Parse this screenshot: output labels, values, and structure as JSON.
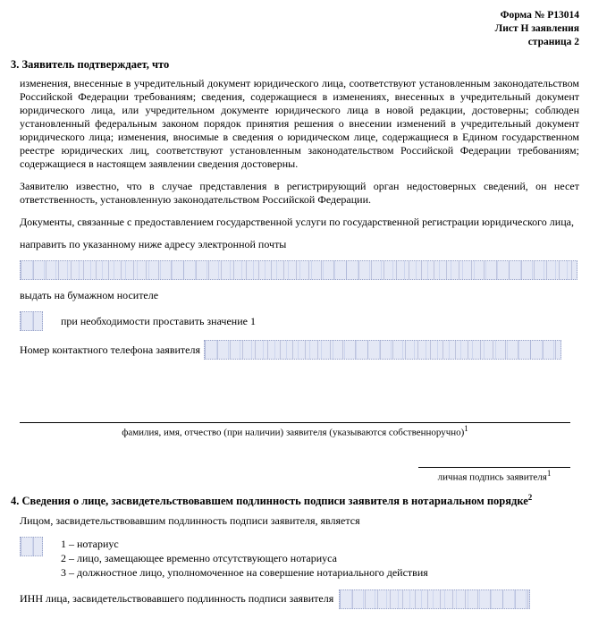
{
  "header": {
    "form_no": "Форма № Р13014",
    "sheet": "Лист Н заявления",
    "page": "страница 2"
  },
  "section3": {
    "number_title": "3. Заявитель подтверждает, что",
    "para1": "изменения, внесенные в учредительный документ юридического лица, соответствуют установленным законодательством Российской Федерации требованиям; сведения, содержащиеся в изменениях, внесенных в учредительный документ юридического лица, или учредительном документе юридического лица в новой редакции, достоверны; соблюден установленный федеральным законом порядок принятия решения о внесении изменений в учредительный документ юридического лица; изменения, вносимые в сведения о юридическом лице, содержащиеся в Едином государственном реестре юридических лиц, соответствуют установленным законодательством Российской Федерации требованиям; содержащиеся в настоящем заявлении сведения достоверны.",
    "para2": "Заявителю известно, что в случае представления в регистрирующий орган недостоверных сведений, он несет ответственность, установленную законодательством Российской Федерации.",
    "docs_line": "Документы, связанные с предоставлением государственной услуги по государственной регистрации юридического лица,",
    "email_line": "направить по указанному ниже адресу электронной почты",
    "paper_line": "выдать на бумажном носителе",
    "paper_hint": "при необходимости проставить значение 1",
    "phone_label": "Номер контактного телефона заявителя",
    "sig_caption": "фамилия, имя, отчество (при наличии) заявителя (указываются собственноручно)",
    "sig_personal": "личная подпись заявителя"
  },
  "section4": {
    "number_title": "4. Сведения о лице, засвидетельствовавшем подлинность подписи заявителя в нотариальном порядке",
    "intro": "Лицом, засвидетельствовавшим подлинность подписи заявителя, является",
    "opt1": "1 – нотариус",
    "opt2": "2 – лицо, замещающее временно отсутствующего нотариуса",
    "opt3": "3 – должностное лицо, уполномоченное на совершение нотариального действия",
    "inn_label": "ИНН лица, засвидетельствовавшего подлинность подписи заявителя"
  }
}
